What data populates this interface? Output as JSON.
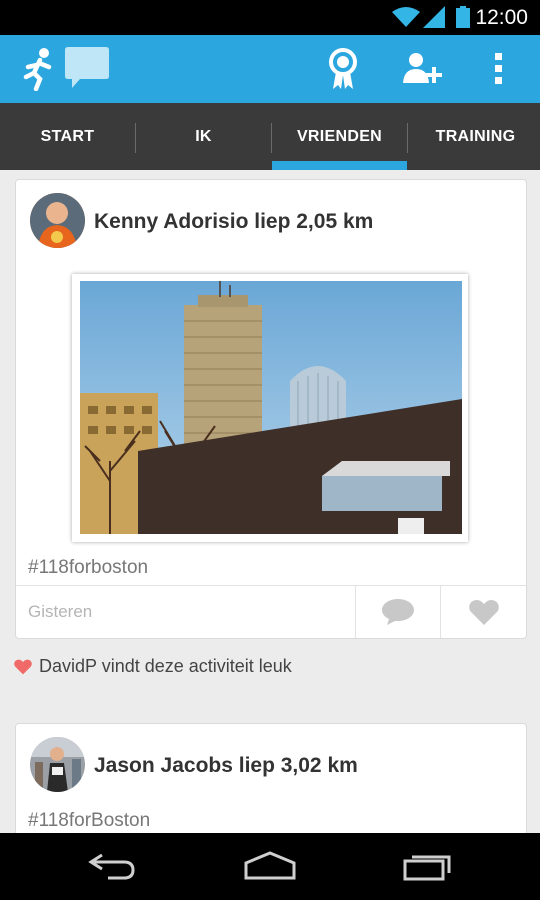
{
  "status_bar": {
    "time": "12:00",
    "icons": [
      "wifi-icon",
      "signal-icon",
      "battery-icon"
    ]
  },
  "action_bar": {
    "icons": [
      "runner-icon",
      "chat-icon",
      "award-icon",
      "add-friend-icon",
      "overflow-menu-icon"
    ],
    "color": "#2ba6de"
  },
  "tabs": [
    {
      "label": "START"
    },
    {
      "label": "IK"
    },
    {
      "label": "VRIENDEN"
    },
    {
      "label": "TRAINING"
    }
  ],
  "selected_tab": "VRIENDEN",
  "feed": {
    "posts": [
      {
        "title": "Kenny Adorisio liep 2,05 km",
        "hashtag": "#118forboston",
        "date": "Gisteren"
      },
      {
        "title": "Jason Jacobs liep 3,02 km",
        "hashtag": "#118forBoston"
      }
    ],
    "like_text": "DavidP vindt deze activiteit leuk"
  },
  "colors": {
    "accent": "#2ba6de",
    "tab_bar": "#3a3a3a",
    "heart": "#f06a6a"
  }
}
